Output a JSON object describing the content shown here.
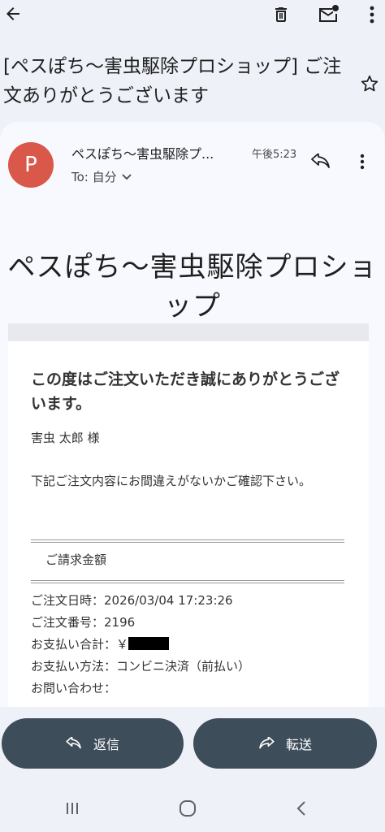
{
  "email": {
    "subject": "[ペスぽち〜害虫駆除プロショップ] ご注文ありがとうございます",
    "avatar_letter": "P",
    "sender": "ペスぽち〜害虫駆除プ...",
    "time": "午後5:23",
    "to": "To: 自分",
    "avatar_color": "#d9584a"
  },
  "body": {
    "shop_title": "ペスぽち〜害虫駆除プロショップ",
    "thanks": "この度はご注文いただき誠にありがとうございます。",
    "customer": "害虫 太郎 様",
    "notice": "下記ご注文内容にお間違えがないかご確認下さい。",
    "billing_header": "ご請求金額",
    "order_datetime": "ご注文日時：2026/03/04 17:23:26",
    "order_number": "ご注文番号：2196",
    "payment_total_label": "お支払い合計：￥",
    "payment_method": "お支払い方法：コンビニ決済（前払い）",
    "inquiry": "お問い合わせ："
  },
  "actions": {
    "reply_label": "返信",
    "forward_label": "転送",
    "button_color": "#3e4d5a"
  },
  "icons": {
    "back": "arrow-left-icon",
    "delete": "trash-icon",
    "unread": "mail-unread-icon",
    "more": "more-vert-icon",
    "star": "star-outline-icon",
    "reply": "reply-icon",
    "forward": "forward-icon"
  }
}
